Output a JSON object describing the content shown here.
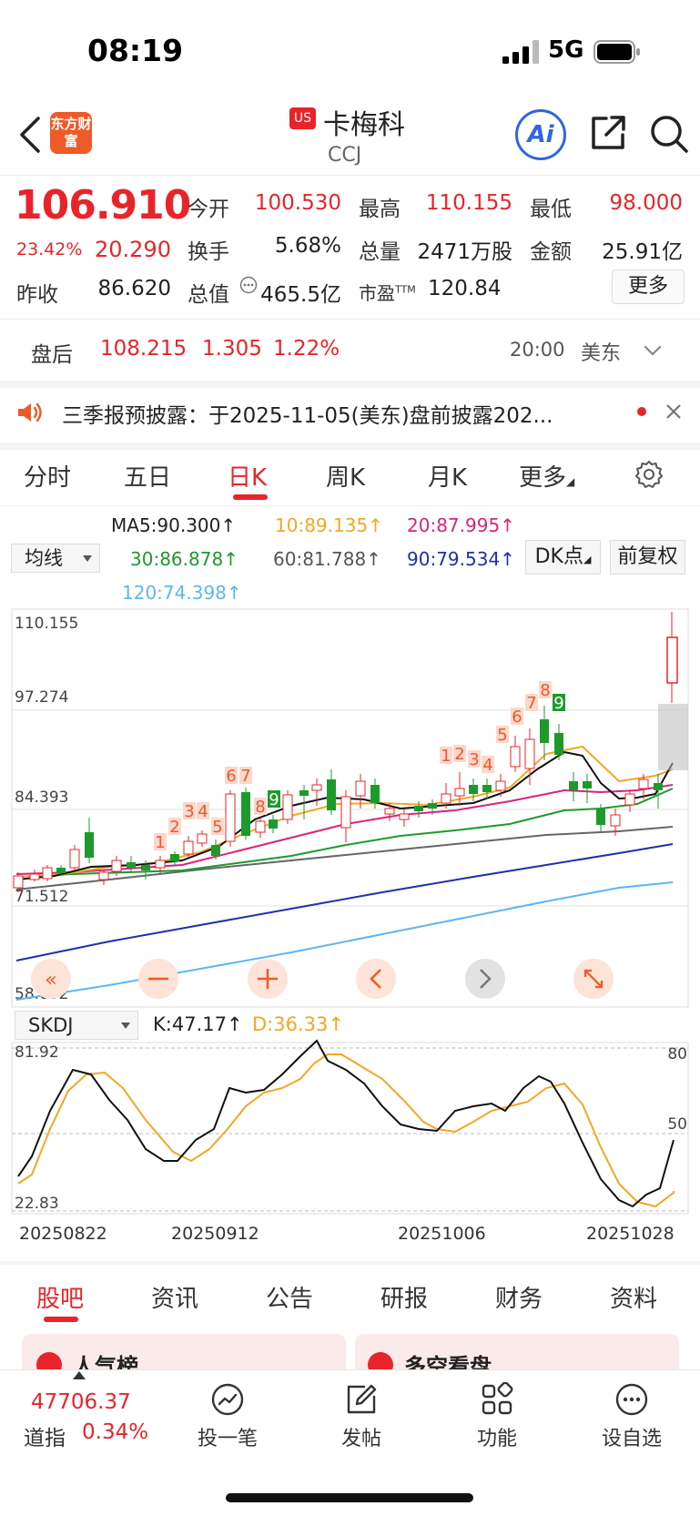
{
  "status_bar": {
    "time": "08:19",
    "network": "5G"
  },
  "header": {
    "logo_text": "东方财富",
    "market_badge": "US",
    "stock_name": "卡梅科",
    "stock_code": "CCJ",
    "ai_label": "Ai"
  },
  "quote": {
    "price": "106.910",
    "change_pct": "23.42%",
    "change": "20.290",
    "open_label": "今开",
    "open": "100.530",
    "high_label": "最高",
    "high": "110.155",
    "low_label": "最低",
    "low": "98.000",
    "turnover_label": "换手",
    "turnover": "5.68%",
    "volume_label": "总量",
    "volume": "2471万股",
    "amount_label": "金额",
    "amount": "25.91亿",
    "prev_close_label": "昨收",
    "prev_close": "86.620",
    "mktcap_label": "总值",
    "mktcap": "465.5亿",
    "pe_label": "市盈",
    "pe_sup": "TTM",
    "pe": "120.84",
    "more_label": "更多"
  },
  "after_hours": {
    "label": "盘后",
    "price": "108.215",
    "change": "1.305",
    "change_pct": "1.22%",
    "time": "20:00",
    "zone": "美东"
  },
  "notice": {
    "text": "三季报预披露：于2025-11-05(美东)盘前披露202..."
  },
  "period_tabs": [
    "分时",
    "五日",
    "日K",
    "周K",
    "月K",
    "更多"
  ],
  "ma": {
    "selector": "均线",
    "ma5": "MA5:90.300↑",
    "ma10": "10:89.135↑",
    "ma20": "20:87.995↑",
    "ma30": "30:86.878↑",
    "ma60": "60:81.788↑",
    "ma90": "90:79.534↑",
    "ma120": "120:74.398↑",
    "dk_button": "DK点",
    "adjust_button": "前复权"
  },
  "main_chart": {
    "price_labels": [
      "110.155",
      "97.274",
      "84.393",
      "71.512",
      "58.632"
    ],
    "td_labels": [
      "1",
      "2",
      "3",
      "4",
      "5",
      "6",
      "7",
      "8",
      "9",
      "1",
      "2",
      "3",
      "4",
      "5",
      "6",
      "7",
      "8",
      "9"
    ]
  },
  "skdj": {
    "selector": "SKDJ",
    "k": "K:47.17↑",
    "d": "D:36.33↑",
    "y_left_top": "81.92",
    "y_left_bottom": "22.83",
    "y_right_top": "80",
    "y_right_mid": "50"
  },
  "x_dates": [
    "20250822",
    "20250912",
    "20251006",
    "20251028"
  ],
  "bottom_tabs": [
    "股吧",
    "资讯",
    "公告",
    "研报",
    "财务",
    "资料"
  ],
  "cards": {
    "left": "人气榜",
    "right": "多空看盘"
  },
  "bottom_nav": {
    "index_value": "47706.37",
    "index_name": "道指",
    "index_pct": "0.34%",
    "items": [
      "投一笔",
      "发帖",
      "功能",
      "设自选"
    ]
  },
  "colors": {
    "up": "#e8242a",
    "down": "#1e9a2c",
    "accent": "#e8242a"
  }
}
